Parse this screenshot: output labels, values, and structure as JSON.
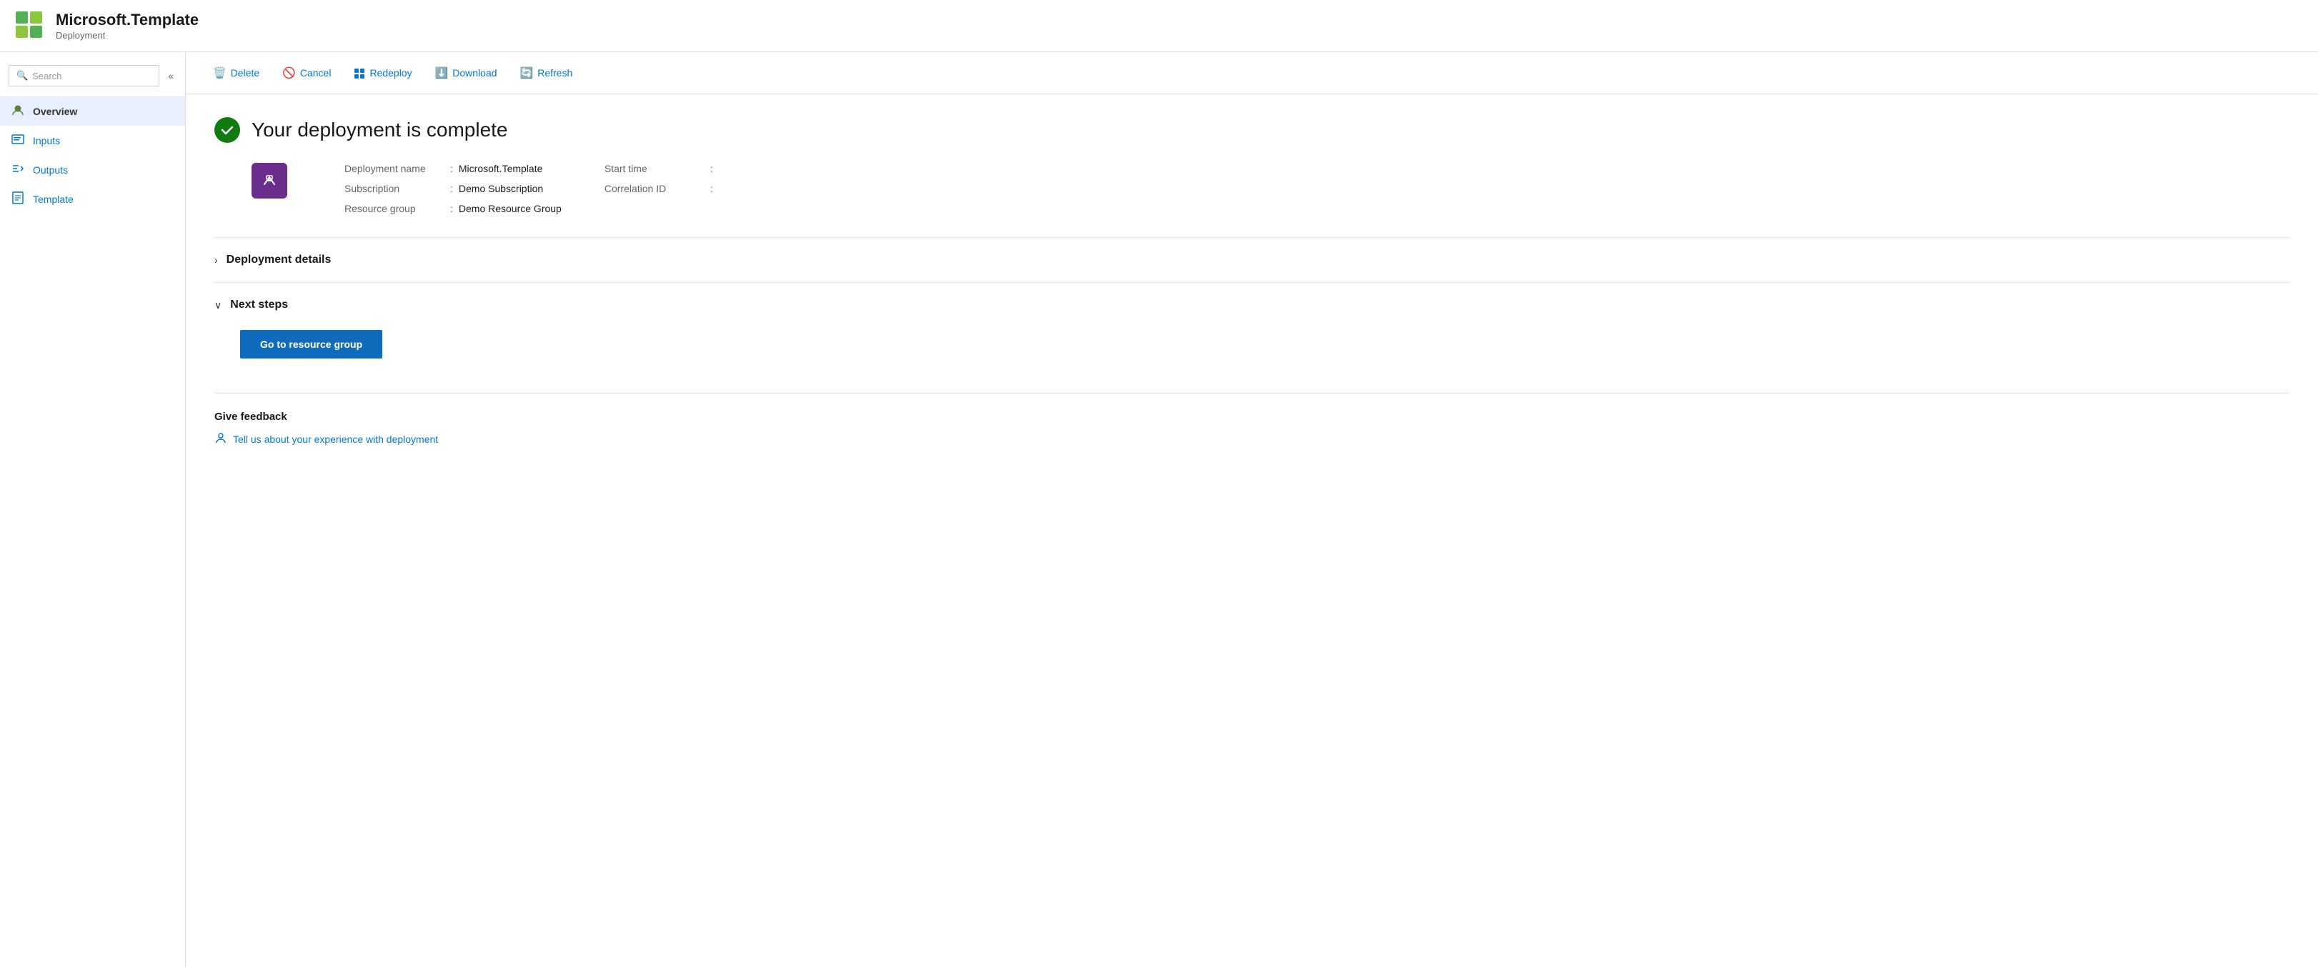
{
  "header": {
    "title": "Microsoft.Template",
    "subtitle": "Deployment",
    "icon_alt": "microsoft-template-icon"
  },
  "sidebar": {
    "search_placeholder": "Search",
    "collapse_label": "«",
    "nav_items": [
      {
        "id": "overview",
        "label": "Overview",
        "icon": "overview-icon",
        "active": true
      },
      {
        "id": "inputs",
        "label": "Inputs",
        "icon": "inputs-icon",
        "active": false
      },
      {
        "id": "outputs",
        "label": "Outputs",
        "icon": "outputs-icon",
        "active": false
      },
      {
        "id": "template",
        "label": "Template",
        "icon": "template-icon",
        "active": false
      }
    ]
  },
  "toolbar": {
    "delete_label": "Delete",
    "cancel_label": "Cancel",
    "redeploy_label": "Redeploy",
    "download_label": "Download",
    "refresh_label": "Refresh"
  },
  "main": {
    "deployment_complete_title": "Your deployment is complete",
    "deployment_name_label": "Deployment name",
    "deployment_name_value": "Microsoft.Template",
    "subscription_label": "Subscription",
    "subscription_value": "Demo Subscription",
    "resource_group_label": "Resource group",
    "resource_group_value": "Demo Resource Group",
    "start_time_label": "Start time",
    "start_time_value": "",
    "correlation_id_label": "Correlation ID",
    "correlation_id_value": "",
    "deployment_details_label": "Deployment details",
    "next_steps_label": "Next steps",
    "go_to_resource_group_label": "Go to resource group",
    "feedback_title": "Give feedback",
    "feedback_link": "Tell us about your experience with deployment"
  }
}
